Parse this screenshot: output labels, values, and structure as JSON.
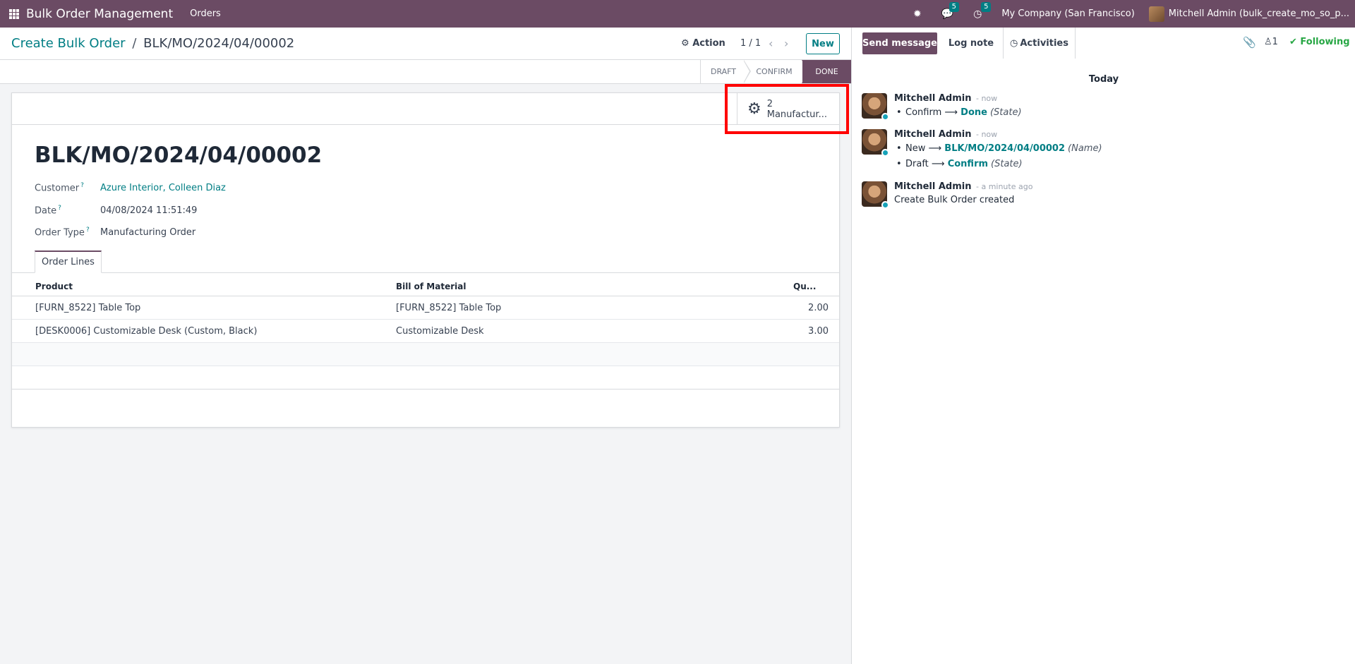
{
  "navbar": {
    "app_name": "Bulk Order Management",
    "menu_orders": "Orders",
    "messages_count": "5",
    "activities_count": "5",
    "company": "My Company (San Francisco)",
    "user": "Mitchell Admin (bulk_create_mo_so_p..."
  },
  "control": {
    "breadcrumb_parent": "Create Bulk Order",
    "breadcrumb_sep": "/",
    "breadcrumb_current": "BLK/MO/2024/04/00002",
    "action_label": "Action",
    "pager": "1 / 1",
    "new_label": "New"
  },
  "status": {
    "stages": [
      "DRAFT",
      "CONFIRM",
      "DONE"
    ],
    "active": "DONE"
  },
  "smart_button": {
    "count": "2",
    "label": "Manufactur..."
  },
  "form": {
    "title": "BLK/MO/2024/04/00002",
    "customer_label": "Customer",
    "customer_value": "Azure Interior, Colleen Diaz",
    "date_label": "Date",
    "date_value": "04/08/2024 11:51:49",
    "order_type_label": "Order Type",
    "order_type_value": "Manufacturing Order",
    "help_mark": "?",
    "tab_label": "Order Lines"
  },
  "table": {
    "headers": {
      "product": "Product",
      "bom": "Bill of Material",
      "qty": "Qu..."
    },
    "rows": [
      {
        "product": "[FURN_8522] Table Top",
        "bom": "[FURN_8522] Table Top",
        "qty": "2.00"
      },
      {
        "product": "[DESK0006] Customizable Desk (Custom, Black)",
        "bom": "Customizable Desk",
        "qty": "3.00"
      }
    ]
  },
  "chatter": {
    "send_message": "Send message",
    "log_note": "Log note",
    "activities": "Activities",
    "followers_count": "1",
    "following": "Following",
    "today": "Today",
    "messages": [
      {
        "author": "Mitchell Admin",
        "time": "- now",
        "changes": [
          {
            "from": "Confirm",
            "to": "Done",
            "field": "(State)"
          }
        ]
      },
      {
        "author": "Mitchell Admin",
        "time": "- now",
        "changes": [
          {
            "from": "New",
            "to": "BLK/MO/2024/04/00002",
            "field": "(Name)"
          },
          {
            "from": "Draft",
            "to": "Confirm",
            "field": "(State)"
          }
        ]
      },
      {
        "author": "Mitchell Admin",
        "time": "- a minute ago",
        "body": "Create Bulk Order created"
      }
    ]
  },
  "colors": {
    "brand": "#6b4b64",
    "link": "#017e84",
    "highlight": "#ff0000",
    "following": "#28a745"
  }
}
